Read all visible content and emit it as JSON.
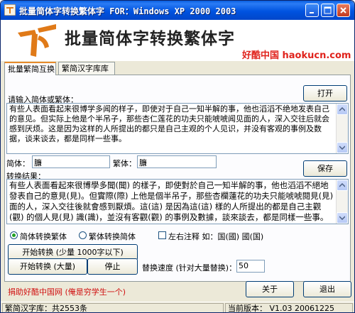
{
  "window": {
    "title": "批量简体字转换繁体字  FOR：Windows XP 2000 2003"
  },
  "header": {
    "heading": "批量简体字转换繁体字",
    "brand": "好酷中国 haokucn.com"
  },
  "tabs": [
    {
      "label": "批量繁简互换",
      "active": true
    },
    {
      "label": "繁简汉字库库",
      "active": false
    }
  ],
  "input": {
    "label": "请输入简体或繁体：",
    "open_button": "打开",
    "text": "有些人表面看起来很博学多闻的样子，即使对于自己一知半解的事，他也滔滔不绝地发表自己的意见。但实际上他是个半吊子，那些杏仁莲花的功夫只能唬唬闻见面的人，深入交往后就会感到厌烦。这是因为这样的人所提出的都只是自己主观的个人见识，并没有客观的事例及数据，谈来谈去，都是同样一些事。"
  },
  "single": {
    "simp_label": "简体：",
    "simp_value": "臁",
    "trad_label": "繁体：",
    "trad_value": "臁"
  },
  "result": {
    "label": "转换结果：",
    "save_button": "保存",
    "text": "有些人表面看起來很博學多聞(聞) 的樣子，即使對於自己一知半解的事，他也滔滔不絕地發表自己的意見(見)。但實際(際) 上他是個半吊子，那些杏欄蓮花的功夫只能唬唬閱見(見) 面的人，深入交往後就會感到厭煩。這(這) 是因為這(這) 樣的人所提出的都是自己主觀(觀) 的個人見(見) 識(識)，並沒有客觀(觀) 的事例及數據，談來談去，都是同樣一些事。"
  },
  "options": {
    "radio_s2t": "简体转换繁体",
    "radio_t2s": "繁体转换简体",
    "checkbox_note": "左右注释 如：国(國) 國(国)",
    "start_small": "开始转换 (少量 1000字以下)",
    "start_large": "开始转换 (大量)",
    "stop": "停止",
    "speed_label": "替换速度 (针对大量替换)：",
    "speed_value": "50"
  },
  "footer": {
    "donate": "捐助好酷中国网 (俺是穷学生一个)",
    "about": "关于",
    "exit": "退出"
  },
  "status": {
    "lib": "繁简汉字库：共2553条",
    "version": "当前版本： V1.03  20061225"
  },
  "colors": {
    "brand_red": "#e0231c",
    "logo_orange": "#e07a18",
    "title_blue": "#0053e0"
  }
}
